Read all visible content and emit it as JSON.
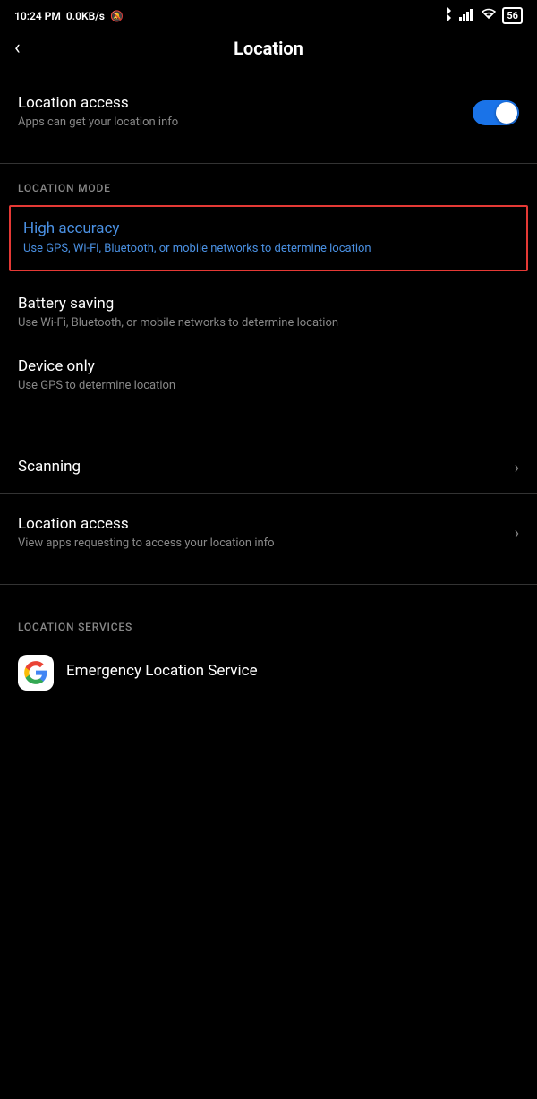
{
  "statusBar": {
    "time": "10:24 PM",
    "network": "0.0KB/s",
    "battery": "56"
  },
  "header": {
    "backLabel": "‹",
    "title": "Location"
  },
  "locationAccess": {
    "title": "Location access",
    "subtitle": "Apps can get your location info",
    "toggleOn": true
  },
  "locationModeHeader": "LOCATION MODE",
  "locationModes": [
    {
      "id": "high-accuracy",
      "title": "High accuracy",
      "subtitle": "Use GPS, Wi-Fi, Bluetooth, or mobile networks to determine location",
      "selected": true
    },
    {
      "id": "battery-saving",
      "title": "Battery saving",
      "subtitle": "Use Wi-Fi, Bluetooth, or mobile networks to determine location",
      "selected": false
    },
    {
      "id": "device-only",
      "title": "Device only",
      "subtitle": "Use GPS to determine location",
      "selected": false
    }
  ],
  "otherSettings": [
    {
      "id": "scanning",
      "title": "Scanning",
      "subtitle": "",
      "hasChevron": true
    },
    {
      "id": "location-access-apps",
      "title": "Location access",
      "subtitle": "View apps requesting to access your location info",
      "hasChevron": true
    }
  ],
  "locationServicesHeader": "LOCATION SERVICES",
  "locationServices": [
    {
      "id": "emergency-location",
      "title": "Emergency Location Service",
      "hasIcon": true
    }
  ]
}
